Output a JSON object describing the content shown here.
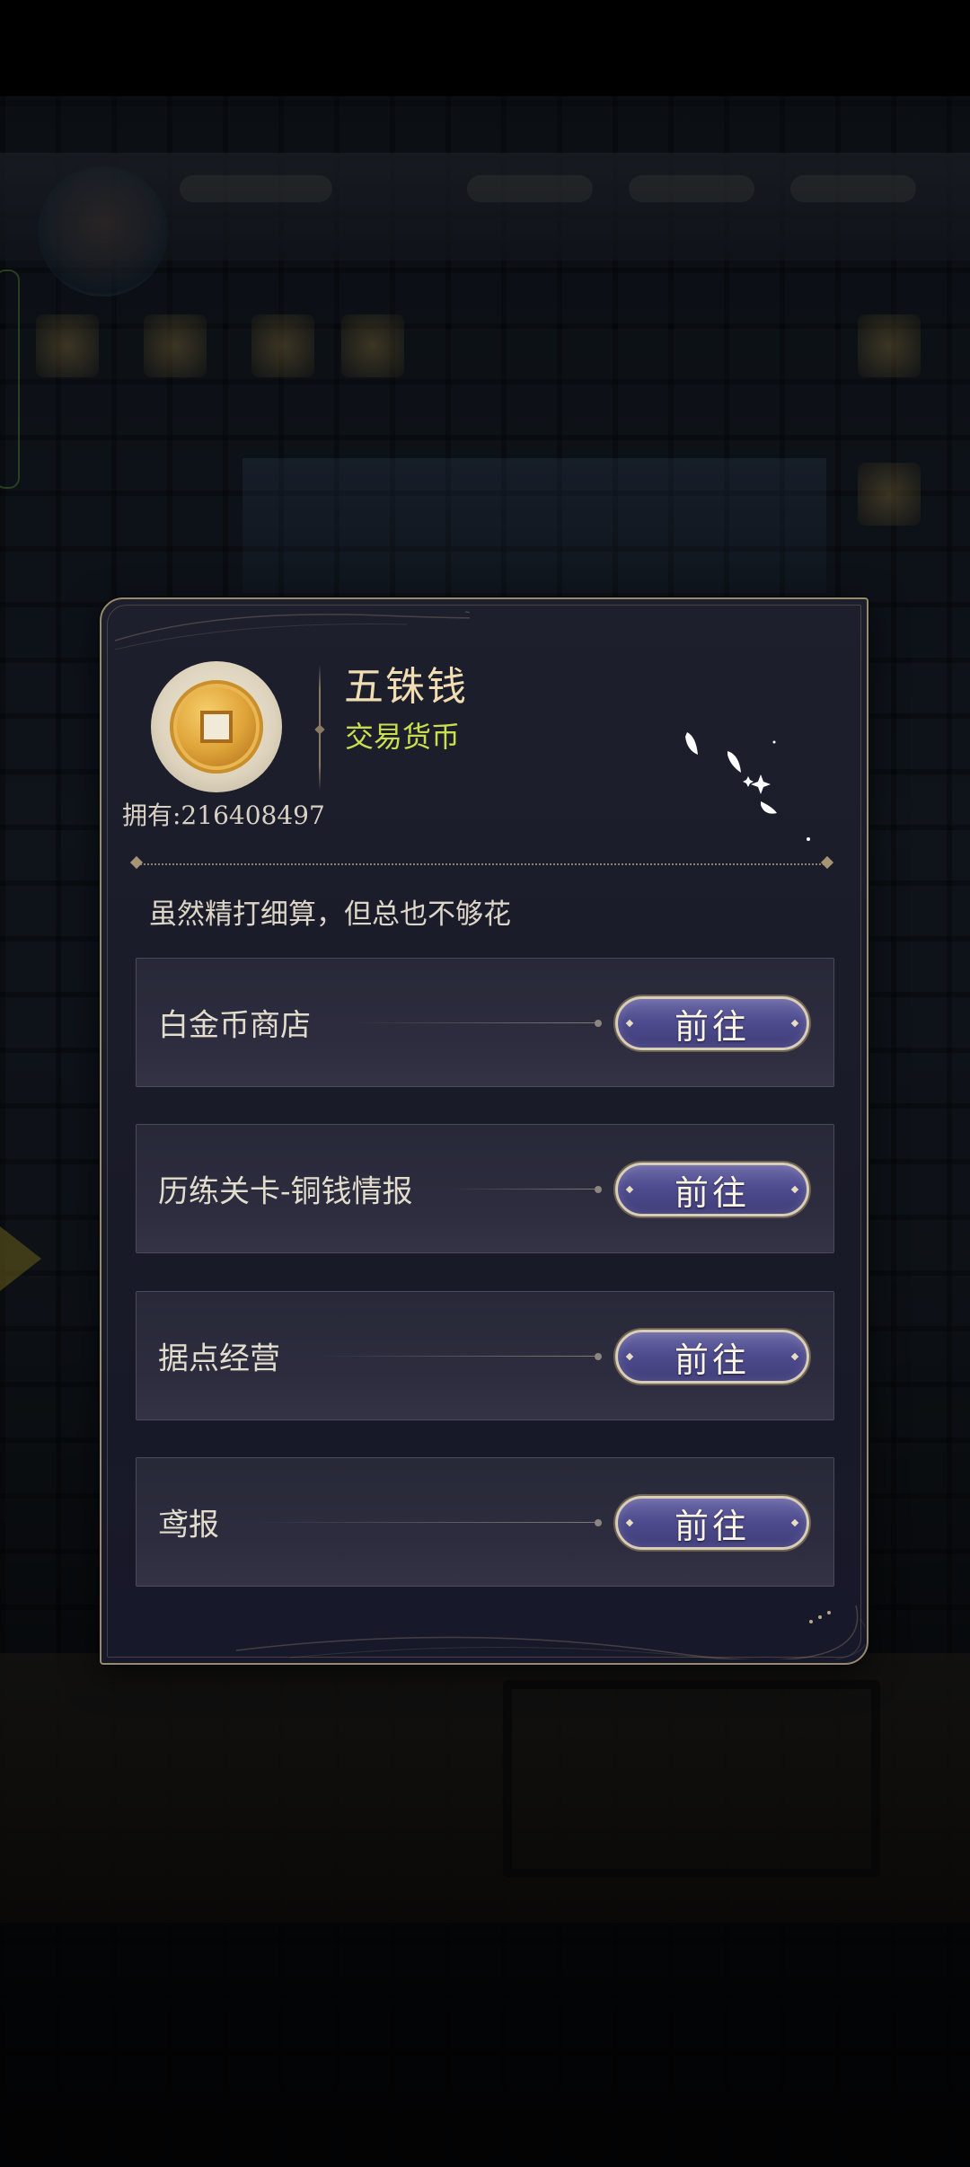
{
  "item": {
    "name": "五铢钱",
    "type": "交易货币",
    "owned_text": "拥有:216408497",
    "description": "虽然精打细算，但总也不够花",
    "icon": "copper-coin-icon"
  },
  "sources": [
    {
      "label": "白金币商店",
      "button": "前往"
    },
    {
      "label": "历练关卡-铜钱情报",
      "button": "前往"
    },
    {
      "label": "据点经营",
      "button": "前往"
    },
    {
      "label": "鸢报",
      "button": "前往"
    }
  ],
  "colors": {
    "title": "#f0ddb2",
    "subtitle": "#c9e04e",
    "button_fill": "#4f4c8f",
    "frame_gold": "#9a8a6c"
  }
}
